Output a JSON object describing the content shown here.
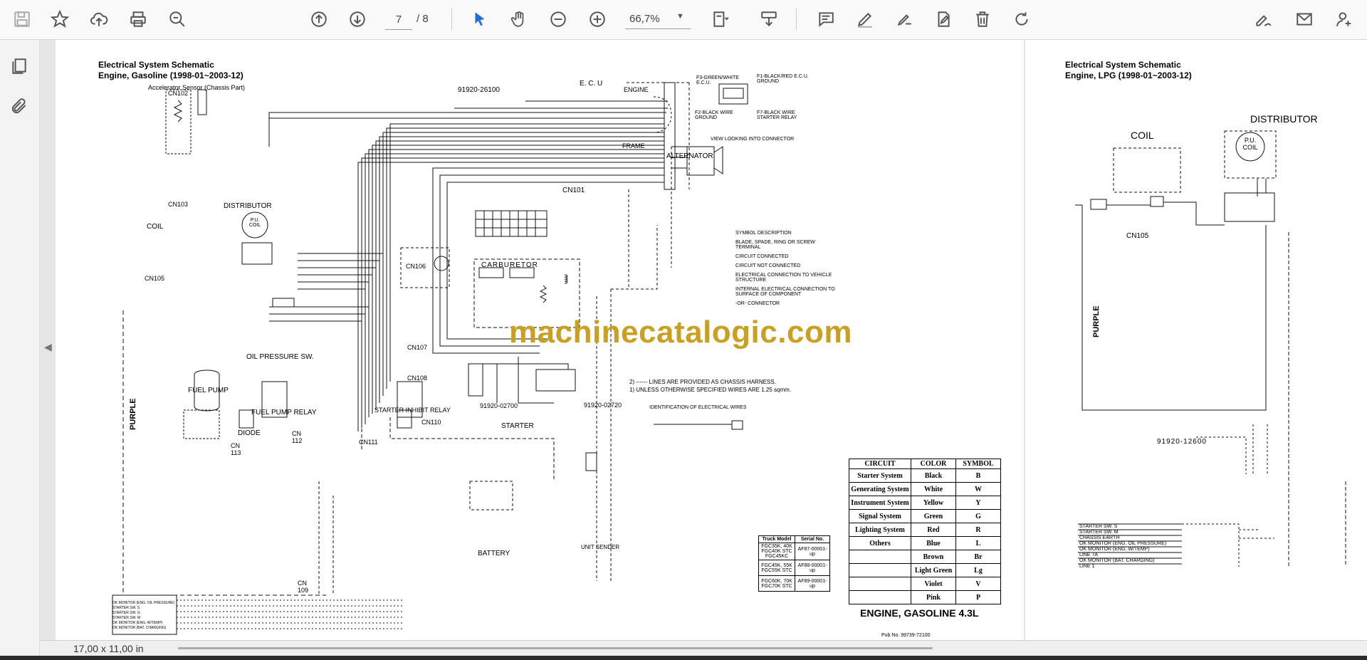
{
  "toolbar": {
    "page_current": "7",
    "page_total": "/ 8",
    "zoom": "66,7%",
    "icons": [
      "save-icon",
      "bookmark-star-icon",
      "upload-cloud-icon",
      "print-icon",
      "zoom-search-icon",
      "page-up-icon",
      "page-down-icon",
      "cursor-select-icon",
      "hand-pan-icon",
      "zoom-out-icon",
      "zoom-in-icon",
      "page-fit-icon",
      "download-tray-icon",
      "comment-icon",
      "pen-icon",
      "highlight-pen-icon",
      "stamp-icon",
      "trash-icon",
      "rotate-redo-icon",
      "sign-icon",
      "mail-icon",
      "add-user-icon"
    ]
  },
  "sidebar": {
    "icons": [
      "pages-thumbnails-icon",
      "attachment-icon"
    ]
  },
  "status": {
    "dimensions": "17,00 x 11,00 in"
  },
  "watermark": "machinecatalogic.com",
  "left_page": {
    "title1": "Electrical System Schematic",
    "title2": "Engine, Gasoline (1998-01~2003-12)",
    "subtitle": "Accelerator Sensor (Chassis Part)",
    "labels": {
      "part_no_top": "91920-26100",
      "ecu": "E. C. U",
      "cn101": "CN101",
      "cn102": "CN102",
      "cn103": "CN103",
      "cn105": "CN105",
      "cn106": "CN106",
      "cn107": "CN107",
      "cn108": "CN108",
      "cn110": "CN110",
      "cn111": "CN111",
      "distributor": "DISTRIBUTOR",
      "coil": "COIL",
      "pu_coil": "P.U. COIL",
      "carburetor": "CARBURETOR",
      "alternator": "ALTERNATOR",
      "engine": "ENGINE",
      "frame": "FRAME",
      "oil_pressure": "OIL PRESSURE SW.",
      "fuel_pump": "FUEL PUMP",
      "fuel_pump_relay": "FUEL PUMP RELAY",
      "diode": "DIODE",
      "cn113": "CN 113",
      "cn112": "CN 112",
      "starter_inhibit": "STARTER INHIBIT RELAY",
      "starter": "STARTER",
      "part_no_1": "91920-02700",
      "part_no_2": "91920-02720",
      "battery": "BATTERY",
      "unit_sender": "UNIT SENDER",
      "purple": "PURPLE",
      "cn109": "CN 109",
      "view_note": "VIEW LOOKING INTO CONNECTOR",
      "f1": "F1-BLACK/RED E.C.U. GROUND",
      "f2": "F2-BLACK WIRE GROUND",
      "f3": "F3-GREEN/WHITE E.C.U.",
      "f7": "F7-BLACK WIRE STARTER RELAY"
    },
    "symbols": {
      "header": "SYMBOL DESCRIPTION",
      "items": [
        "BLADE, SPADE, RING OR SCREW TERMINAL",
        "CIRCUIT CONNECTED",
        "CIRCUIT NOT CONNECTED",
        "ELECTRICAL CONNECTION TO VEHICLE STRUCTURE",
        "INTERNAL ELECTRICAL CONNECTION TO SURFACE OF COMPONENT",
        "-OR- CONNECTOR"
      ]
    },
    "notes": [
      "2) ------ LINES ARE PROVIDED AS CHASSIS HARNESS.",
      "1) UNLESS OTHERWISE SPECIFIED WIRES ARE 1.25 sqmm."
    ],
    "wire_ident": "IDENTIFICATION OF ELECTRICAL WIRES",
    "circuit_table": {
      "headers": [
        "CIRCUIT",
        "COLOR",
        "SYMBOL"
      ],
      "rows": [
        [
          "Starter System",
          "Black",
          "B"
        ],
        [
          "Generating System",
          "White",
          "W"
        ],
        [
          "Instrument System",
          "Yellow",
          "Y"
        ],
        [
          "Signal System",
          "Green",
          "G"
        ],
        [
          "Lighting System",
          "Red",
          "R"
        ],
        [
          "Others",
          "Blue",
          "L"
        ],
        [
          "",
          "Brown",
          "Br"
        ],
        [
          "",
          "Light Green",
          "Lg"
        ],
        [
          "",
          "Violet",
          "V"
        ],
        [
          "",
          "Pink",
          "P"
        ]
      ]
    },
    "serial_table": {
      "headers": [
        "Truck Model",
        "Serial No."
      ],
      "rows": [
        [
          "FGC35K, 40K FGC40K STC FGC45KC",
          "AF87-00001-up"
        ],
        [
          "FGC45K, 55K FGC55K STC",
          "AF88-00001-up"
        ],
        [
          "FGC60K, 70K FGC70K STC",
          "AF89-00001-up"
        ]
      ]
    },
    "engine_title": "ENGINE, GASOLINE 4.3L",
    "pub_no": "Pub No. 99739-72100",
    "legend_rows": [
      "OK MONITOR (ENG. OIL PRESSURE)",
      "STARTER SW. S",
      "STARTER SW. G",
      "STARTER SW. M",
      "OK MONITOR (ENG. W/TEMP)",
      "OK MONITOR (BAT. CHARGING)"
    ]
  },
  "right_page": {
    "title1": "Electrical System Schematic",
    "title2": "Engine, LPG (1998-01~2003-12)",
    "coil": "COIL",
    "distributor": "DISTRIBUTOR",
    "pu_coil": "P.U. COIL",
    "cn105": "CN105",
    "purple": "PURPLE",
    "part_no": "91920-12600",
    "legend_rows": [
      "STARTER SW. S",
      "STARTER SW. M",
      "CHASSIS EARTH",
      "OK MONITOR (ENG. OIL PRESSURE)",
      "OK MONITOR (ENG. W/TEMP)",
      "LINE 7A",
      "OK MONITOR (BAT. CHARGING)",
      "LINE 1"
    ]
  }
}
